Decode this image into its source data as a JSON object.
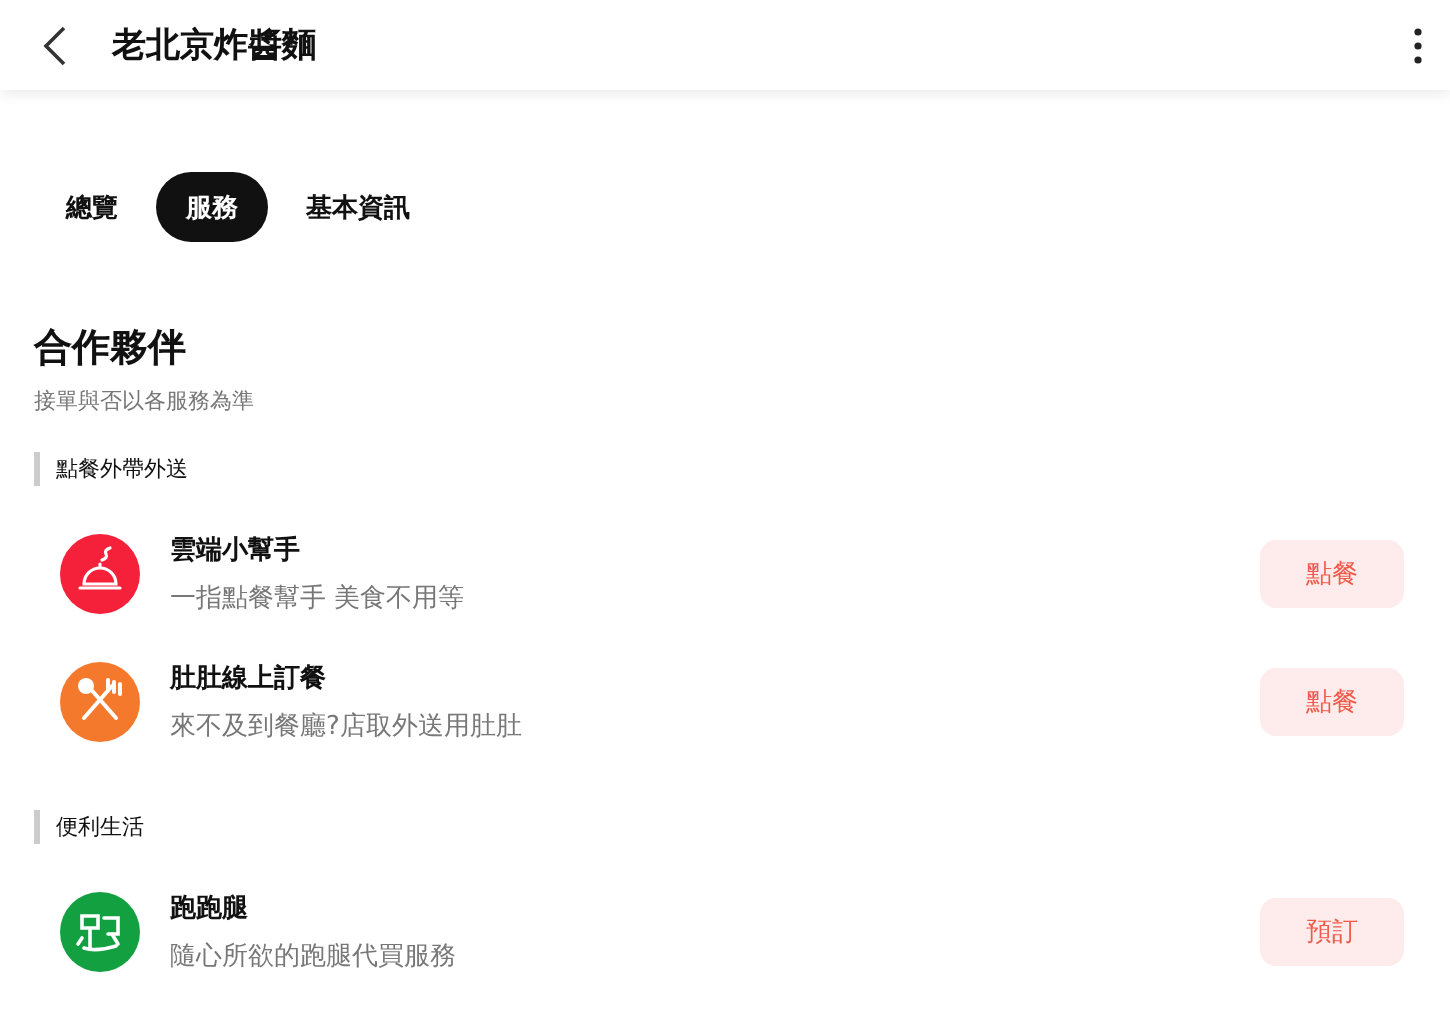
{
  "header": {
    "title": "老北京炸醬麵"
  },
  "tabs": [
    {
      "label": "總覽",
      "selected": false
    },
    {
      "label": "服務",
      "selected": true
    },
    {
      "label": "基本資訊",
      "selected": false
    }
  ],
  "section": {
    "title": "合作夥伴",
    "subtitle": "接單與否以各服務為準"
  },
  "groups": [
    {
      "label": "點餐外帶外送",
      "services": [
        {
          "name": "雲端小幫手",
          "description": "一指點餐幫手 美食不用等",
          "kind": "cloche",
          "color": "#f5213a",
          "action": "點餐"
        },
        {
          "name": "肚肚線上訂餐",
          "description": "來不及到餐廳?店取外送用肚肚",
          "kind": "utensils",
          "color": "#f5792d",
          "action": "點餐"
        }
      ]
    },
    {
      "label": "便利生活",
      "services": [
        {
          "name": "跑跑腿",
          "description": "隨心所欲的跑腿代買服務",
          "kind": "runner",
          "color": "#12a040",
          "action": "預訂"
        }
      ]
    }
  ]
}
